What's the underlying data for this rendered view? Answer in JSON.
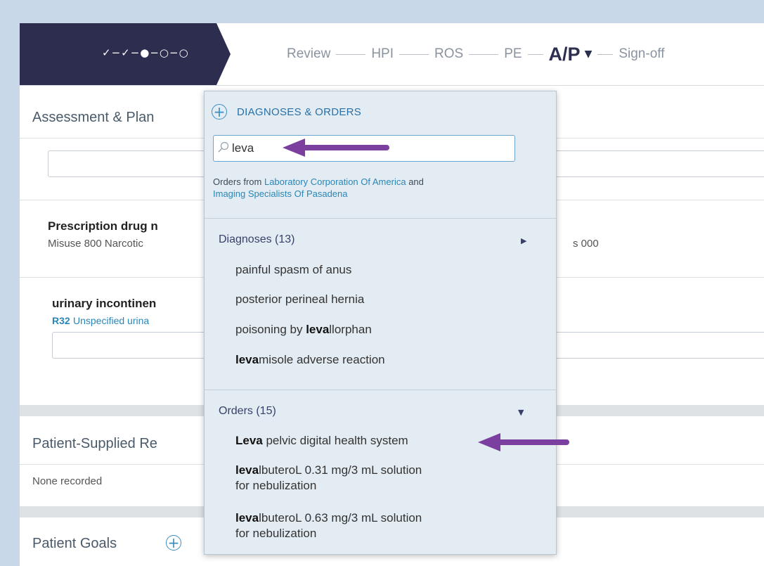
{
  "header": {
    "progress_marks": "✓−✓−●−○−○",
    "steps": [
      "Review",
      "HPI",
      "ROS",
      "PE",
      "A/P",
      "Sign-off"
    ],
    "active_step_caret": "▼"
  },
  "left": {
    "assessment_title": "Assessment & Plan",
    "prescription_title": "Prescription drug n",
    "prescription_sub": "Misuse 800   Narcotic",
    "prescription_tail": "s 000",
    "urinary_title": "urinary incontinen",
    "urinary_code": "R32",
    "urinary_desc": "Unspecified urina",
    "patient_supplied_title": "Patient-Supplied Re",
    "none_recorded": "None recorded",
    "patient_goals_title": "Patient Goals"
  },
  "dropdown": {
    "head_label": "DIAGNOSES & ORDERS",
    "search_value": "leva",
    "orders_from_prefix": "Orders from ",
    "orders_from_lab": "Laboratory Corporation Of America",
    "orders_from_and": " and",
    "orders_from_imaging": "Imaging Specialists Of Pasadena",
    "diagnoses_header": "Diagnoses (13)",
    "diagnoses": [
      {
        "pre": "painful spasm of anus",
        "bold": "",
        "post": ""
      },
      {
        "pre": "posterior perineal hernia",
        "bold": "",
        "post": ""
      },
      {
        "pre": "poisoning by ",
        "bold": "leva",
        "post": "llorphan"
      },
      {
        "pre": "",
        "bold": "leva",
        "post": "misole adverse reaction"
      }
    ],
    "orders_header": "Orders (15)",
    "orders": [
      {
        "bold": "Leva",
        "post": " pelvic digital health system"
      },
      {
        "bold": "leva",
        "post": "lbuteroL 0.31 mg/3 mL solution",
        "line2": "for nebulization"
      },
      {
        "bold": "leva",
        "post": "lbuteroL 0.63 mg/3 mL solution",
        "line2": "for nebulization"
      }
    ]
  },
  "colors": {
    "progress_bg": "#2c2d4f",
    "annotation_arrow": "#7b3fa0",
    "link": "#2a86b7"
  }
}
